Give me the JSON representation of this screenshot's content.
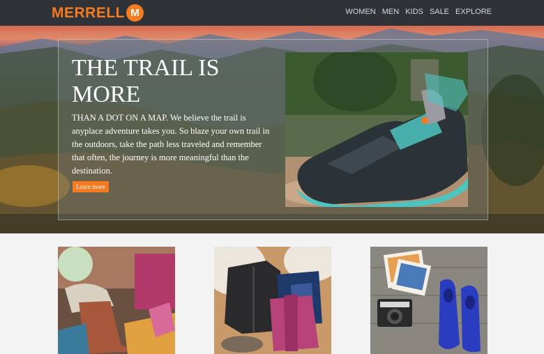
{
  "brand": {
    "logo_text": "MERRELL",
    "logo_mark": "M",
    "color": "#f47b20"
  },
  "nav": {
    "items": [
      "WOMEN",
      "MEN",
      "KIDS",
      "SALE",
      "EXPLORE"
    ]
  },
  "hero": {
    "title": "THE TRAIL IS MORE",
    "body": "THAN A DOT ON A MAP. We believe the trail is anyplace adventure takes you. So blaze your own trail in the outdoors, take the path less traveled and remember that often, the journey is more meaningful than the destination.",
    "button_label": "Learn more",
    "photo_icon": "hiking-shoe-photo"
  },
  "cards": [
    {
      "icon": "boots-lacing-photo"
    },
    {
      "icon": "jackets-flatlay-photo"
    },
    {
      "icon": "camera-shoes-flatlay-photo"
    }
  ],
  "colors": {
    "header_bg": "#2f3236",
    "accent": "#f47b20"
  }
}
